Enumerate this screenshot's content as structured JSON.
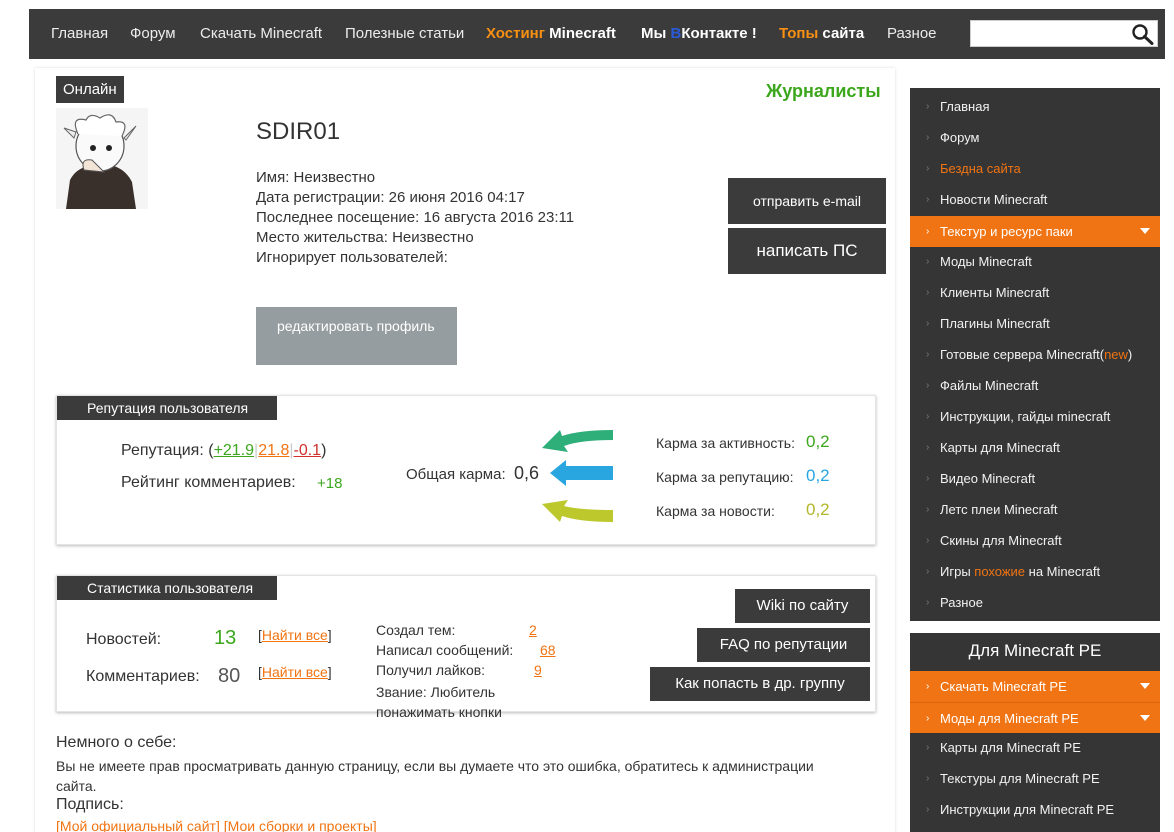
{
  "nav": {
    "home": "Главная",
    "forum": "Форум",
    "download": "Скачать Minecraft",
    "articles": "Полезные статьи",
    "hosting_a": "Хостинг ",
    "hosting_b": "Minecraft",
    "vk_a": "Мы ",
    "vk_v": "В",
    "vk_b": "Контакте !",
    "tops_a": "Топы ",
    "tops_b": "сайта",
    "misc": "Разное",
    "search_placeholder": "",
    "icon": "search-icon"
  },
  "profile": {
    "status": "Онлайн",
    "group": "Журналисты",
    "username": "SDIR01",
    "name": "Имя: Неизвестно",
    "registered": "Дата регистрации: 26 июня 2016 04:17",
    "last_visit": "Последнее посещение: 16 августа 2016 23:11",
    "location": "Место жительства: Неизвестно",
    "ignores": "Игнорирует пользователей:",
    "send_email": "отправить e-mail",
    "send_pm": "написать ПС",
    "edit_profile": "редактировать профиль"
  },
  "reputation": {
    "title": "Репутация пользователя",
    "label": "Репутация: (",
    "total": "+21.9",
    "positive": "21.8",
    "negative": "-0.1",
    "close": ")",
    "comment_rating_label": "Рейтинг комментариев:",
    "comment_rating": "+18",
    "karma_label": "Общая карма:",
    "karma": "0,6",
    "karma_activity_label": "Карма за активность:",
    "karma_activity": "0,2",
    "karma_rep_label": "Карма за репутацию:",
    "karma_rep": "0,2",
    "karma_news_label": "Карма за новости:",
    "karma_news": "0,2",
    "colors": {
      "green": "#2eae79",
      "blue": "#29a6e0",
      "yellow": "#bcc82b"
    }
  },
  "stats": {
    "title": "Статистика пользователя",
    "news_label": "Новостей:",
    "news": "13",
    "comments_label": "Комментариев:",
    "comments": "80",
    "find_all": "Найти все",
    "topics_label": "Создал тем:",
    "topics": "2",
    "posts_label": "Написал сообщений:",
    "posts": "68",
    "likes_label": "Получил лайков:",
    "likes": "9",
    "rank": "Звание: Любитель понажимать кнопки",
    "wiki": "Wiki по сайту",
    "faq": "FAQ по репутации",
    "group_help": "Как попасть в др. группу"
  },
  "about": {
    "title": "Немного о себе:",
    "text": "Вы не имеете прав просматривать данную страницу, если вы думаете что это ошибка, обратитесь к администрации сайта.",
    "signature_title": "Подпись:",
    "signature_link1": "[Мой официальный сайт]",
    "signature_link2": "[Мои сборки и проекты]"
  },
  "sidebar": {
    "items": [
      "Главная",
      "Форум",
      "Бездна сайта",
      "Новости Minecraft",
      "Текстур и ресурс паки",
      "Моды Minecraft",
      "Клиенты Minecraft",
      "Плагины Minecraft",
      "Готовые сервера Minecraft(",
      "Файлы Minecraft",
      "Инструкции, гайды minecraft",
      "Карты для Minecraft",
      "Видео Minecraft",
      "Летс плеи Minecraft",
      "Скины для Minecraft",
      "Игры ",
      "Разное"
    ],
    "new_tag": "new",
    "new_close": ")",
    "games_hl": "похожие",
    "games_tail": " на Minecraft"
  },
  "pe": {
    "title": "Для Minecraft PE",
    "items": [
      "Скачать Minecraft PE",
      "Моды для Minecraft PE",
      "Карты для Minecraft PE",
      "Текстуры для Minecraft PE",
      "Инструкции для Minecraft PE"
    ]
  }
}
